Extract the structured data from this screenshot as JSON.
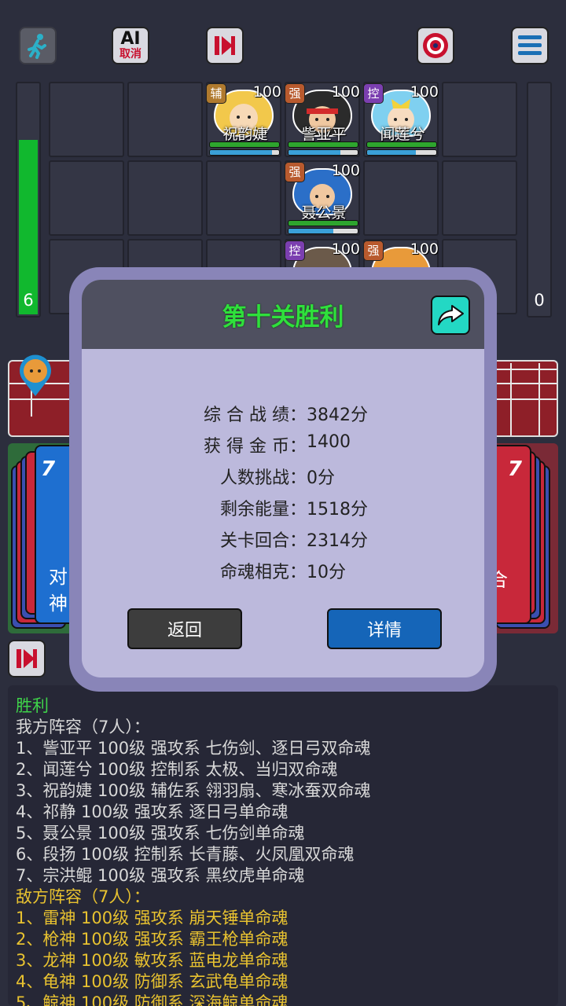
{
  "toolbar": {
    "ai_top": "AI",
    "ai_bottom": "取消"
  },
  "energy_left": "6",
  "energy_left_fraction": 0.75,
  "energy_right": "0",
  "heroes": [
    {
      "role": "辅",
      "level": "100",
      "name": "祝韵婕",
      "mp_fraction": 0.9
    },
    {
      "role": "强",
      "level": "100",
      "name": "訾亚平",
      "mp_fraction": 0.75
    },
    {
      "role": "控",
      "level": "100",
      "name": "闻莲兮",
      "mp_fraction": 0.7
    },
    {
      "role": "强",
      "level": "100",
      "name": "聂公景",
      "mp_fraction": 0.65
    },
    {
      "role": "控",
      "level": "100",
      "name": ""
    },
    {
      "role": "强",
      "level": "100",
      "name": ""
    }
  ],
  "decks": {
    "left_count": "7",
    "left_text_1": "对",
    "left_text_2": "神",
    "right_count": "7",
    "right_text": "合"
  },
  "modal": {
    "title": "第十关胜利",
    "stats": [
      {
        "label": "综 合 战 绩：",
        "value": "3842分"
      },
      {
        "label": "获 得 金 币：",
        "value": "1400"
      },
      {
        "label": "人数挑战：",
        "value": "0分"
      },
      {
        "label": "剩余能量：",
        "value": "1518分"
      },
      {
        "label": "关卡回合：",
        "value": "2314分"
      },
      {
        "label": "命魂相克：",
        "value": "10分"
      }
    ],
    "back_label": "返回",
    "detail_label": "详情"
  },
  "log": {
    "result": "胜利",
    "our_header": "我方阵容（7人）：",
    "our": [
      "1、訾亚平 100级 强攻系 七伤剑、逐日弓双命魂",
      "2、闻莲兮 100级 控制系 太极、当归双命魂",
      "3、祝韵婕 100级 辅佐系 翎羽扇、寒冰蚕双命魂",
      "4、祁静 100级 强攻系 逐日弓单命魂",
      "5、聂公景 100级 强攻系 七伤剑单命魂",
      "6、段扬 100级 控制系 长青藤、火凤凰双命魂",
      "7、宗洪鲲 100级 强攻系 黑纹虎单命魂"
    ],
    "enemy_header": "敌方阵容（7人）：",
    "enemy": [
      "1、雷神 100级 强攻系 崩天锤单命魂",
      "2、枪神 100级 强攻系 霸王枪单命魂",
      "3、龙神 100级 敏攻系 蓝电龙单命魂",
      "4、龟神 100级 防御系 玄武龟单命魂",
      "5、鲸神 100级 防御系 深海鲸单命魂"
    ]
  }
}
